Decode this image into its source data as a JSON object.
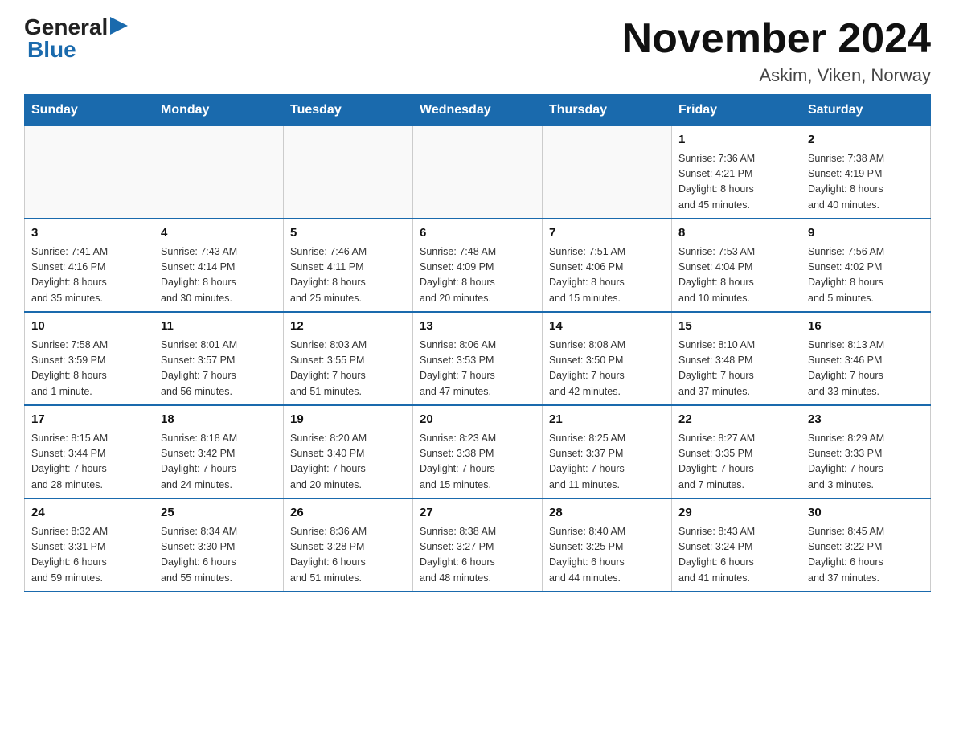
{
  "logo": {
    "general": "General",
    "blue": "Blue",
    "arrow": "▶"
  },
  "title": "November 2024",
  "subtitle": "Askim, Viken, Norway",
  "weekdays": [
    "Sunday",
    "Monday",
    "Tuesday",
    "Wednesday",
    "Thursday",
    "Friday",
    "Saturday"
  ],
  "weeks": [
    [
      {
        "day": "",
        "info": ""
      },
      {
        "day": "",
        "info": ""
      },
      {
        "day": "",
        "info": ""
      },
      {
        "day": "",
        "info": ""
      },
      {
        "day": "",
        "info": ""
      },
      {
        "day": "1",
        "info": "Sunrise: 7:36 AM\nSunset: 4:21 PM\nDaylight: 8 hours\nand 45 minutes."
      },
      {
        "day": "2",
        "info": "Sunrise: 7:38 AM\nSunset: 4:19 PM\nDaylight: 8 hours\nand 40 minutes."
      }
    ],
    [
      {
        "day": "3",
        "info": "Sunrise: 7:41 AM\nSunset: 4:16 PM\nDaylight: 8 hours\nand 35 minutes."
      },
      {
        "day": "4",
        "info": "Sunrise: 7:43 AM\nSunset: 4:14 PM\nDaylight: 8 hours\nand 30 minutes."
      },
      {
        "day": "5",
        "info": "Sunrise: 7:46 AM\nSunset: 4:11 PM\nDaylight: 8 hours\nand 25 minutes."
      },
      {
        "day": "6",
        "info": "Sunrise: 7:48 AM\nSunset: 4:09 PM\nDaylight: 8 hours\nand 20 minutes."
      },
      {
        "day": "7",
        "info": "Sunrise: 7:51 AM\nSunset: 4:06 PM\nDaylight: 8 hours\nand 15 minutes."
      },
      {
        "day": "8",
        "info": "Sunrise: 7:53 AM\nSunset: 4:04 PM\nDaylight: 8 hours\nand 10 minutes."
      },
      {
        "day": "9",
        "info": "Sunrise: 7:56 AM\nSunset: 4:02 PM\nDaylight: 8 hours\nand 5 minutes."
      }
    ],
    [
      {
        "day": "10",
        "info": "Sunrise: 7:58 AM\nSunset: 3:59 PM\nDaylight: 8 hours\nand 1 minute."
      },
      {
        "day": "11",
        "info": "Sunrise: 8:01 AM\nSunset: 3:57 PM\nDaylight: 7 hours\nand 56 minutes."
      },
      {
        "day": "12",
        "info": "Sunrise: 8:03 AM\nSunset: 3:55 PM\nDaylight: 7 hours\nand 51 minutes."
      },
      {
        "day": "13",
        "info": "Sunrise: 8:06 AM\nSunset: 3:53 PM\nDaylight: 7 hours\nand 47 minutes."
      },
      {
        "day": "14",
        "info": "Sunrise: 8:08 AM\nSunset: 3:50 PM\nDaylight: 7 hours\nand 42 minutes."
      },
      {
        "day": "15",
        "info": "Sunrise: 8:10 AM\nSunset: 3:48 PM\nDaylight: 7 hours\nand 37 minutes."
      },
      {
        "day": "16",
        "info": "Sunrise: 8:13 AM\nSunset: 3:46 PM\nDaylight: 7 hours\nand 33 minutes."
      }
    ],
    [
      {
        "day": "17",
        "info": "Sunrise: 8:15 AM\nSunset: 3:44 PM\nDaylight: 7 hours\nand 28 minutes."
      },
      {
        "day": "18",
        "info": "Sunrise: 8:18 AM\nSunset: 3:42 PM\nDaylight: 7 hours\nand 24 minutes."
      },
      {
        "day": "19",
        "info": "Sunrise: 8:20 AM\nSunset: 3:40 PM\nDaylight: 7 hours\nand 20 minutes."
      },
      {
        "day": "20",
        "info": "Sunrise: 8:23 AM\nSunset: 3:38 PM\nDaylight: 7 hours\nand 15 minutes."
      },
      {
        "day": "21",
        "info": "Sunrise: 8:25 AM\nSunset: 3:37 PM\nDaylight: 7 hours\nand 11 minutes."
      },
      {
        "day": "22",
        "info": "Sunrise: 8:27 AM\nSunset: 3:35 PM\nDaylight: 7 hours\nand 7 minutes."
      },
      {
        "day": "23",
        "info": "Sunrise: 8:29 AM\nSunset: 3:33 PM\nDaylight: 7 hours\nand 3 minutes."
      }
    ],
    [
      {
        "day": "24",
        "info": "Sunrise: 8:32 AM\nSunset: 3:31 PM\nDaylight: 6 hours\nand 59 minutes."
      },
      {
        "day": "25",
        "info": "Sunrise: 8:34 AM\nSunset: 3:30 PM\nDaylight: 6 hours\nand 55 minutes."
      },
      {
        "day": "26",
        "info": "Sunrise: 8:36 AM\nSunset: 3:28 PM\nDaylight: 6 hours\nand 51 minutes."
      },
      {
        "day": "27",
        "info": "Sunrise: 8:38 AM\nSunset: 3:27 PM\nDaylight: 6 hours\nand 48 minutes."
      },
      {
        "day": "28",
        "info": "Sunrise: 8:40 AM\nSunset: 3:25 PM\nDaylight: 6 hours\nand 44 minutes."
      },
      {
        "day": "29",
        "info": "Sunrise: 8:43 AM\nSunset: 3:24 PM\nDaylight: 6 hours\nand 41 minutes."
      },
      {
        "day": "30",
        "info": "Sunrise: 8:45 AM\nSunset: 3:22 PM\nDaylight: 6 hours\nand 37 minutes."
      }
    ]
  ]
}
